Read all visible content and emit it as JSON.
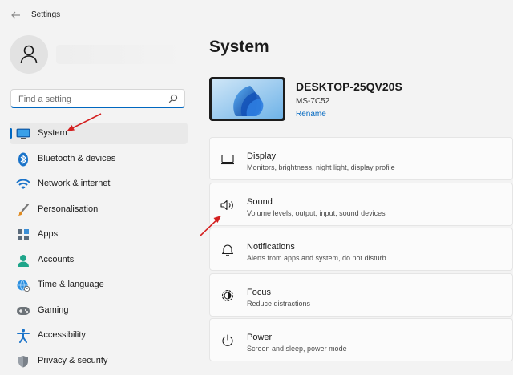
{
  "app": {
    "title": "Settings"
  },
  "search": {
    "placeholder": "Find a setting"
  },
  "sidebar": {
    "items": [
      {
        "label": "System",
        "icon": "monitor-icon",
        "active": true
      },
      {
        "label": "Bluetooth & devices",
        "icon": "bluetooth-icon"
      },
      {
        "label": "Network & internet",
        "icon": "wifi-icon"
      },
      {
        "label": "Personalisation",
        "icon": "brush-icon"
      },
      {
        "label": "Apps",
        "icon": "apps-icon"
      },
      {
        "label": "Accounts",
        "icon": "person-icon"
      },
      {
        "label": "Time & language",
        "icon": "globe-clock-icon"
      },
      {
        "label": "Gaming",
        "icon": "gamepad-icon"
      },
      {
        "label": "Accessibility",
        "icon": "accessibility-icon"
      },
      {
        "label": "Privacy & security",
        "icon": "shield-icon"
      }
    ]
  },
  "main": {
    "title": "System",
    "device": {
      "name": "DESKTOP-25QV20S",
      "model": "MS-7C52",
      "rename": "Rename"
    },
    "cards": [
      {
        "title": "Display",
        "subtitle": "Monitors, brightness, night light, display profile",
        "icon": "display-icon"
      },
      {
        "title": "Sound",
        "subtitle": "Volume levels, output, input, sound devices",
        "icon": "speaker-icon"
      },
      {
        "title": "Notifications",
        "subtitle": "Alerts from apps and system, do not disturb",
        "icon": "bell-icon"
      },
      {
        "title": "Focus",
        "subtitle": "Reduce distractions",
        "icon": "focus-icon"
      },
      {
        "title": "Power",
        "subtitle": "Screen and sleep, power mode",
        "icon": "power-icon"
      }
    ]
  },
  "colors": {
    "accent": "#0067c0",
    "annotation_arrow": "#d42020",
    "background": "#f3f3f3"
  }
}
